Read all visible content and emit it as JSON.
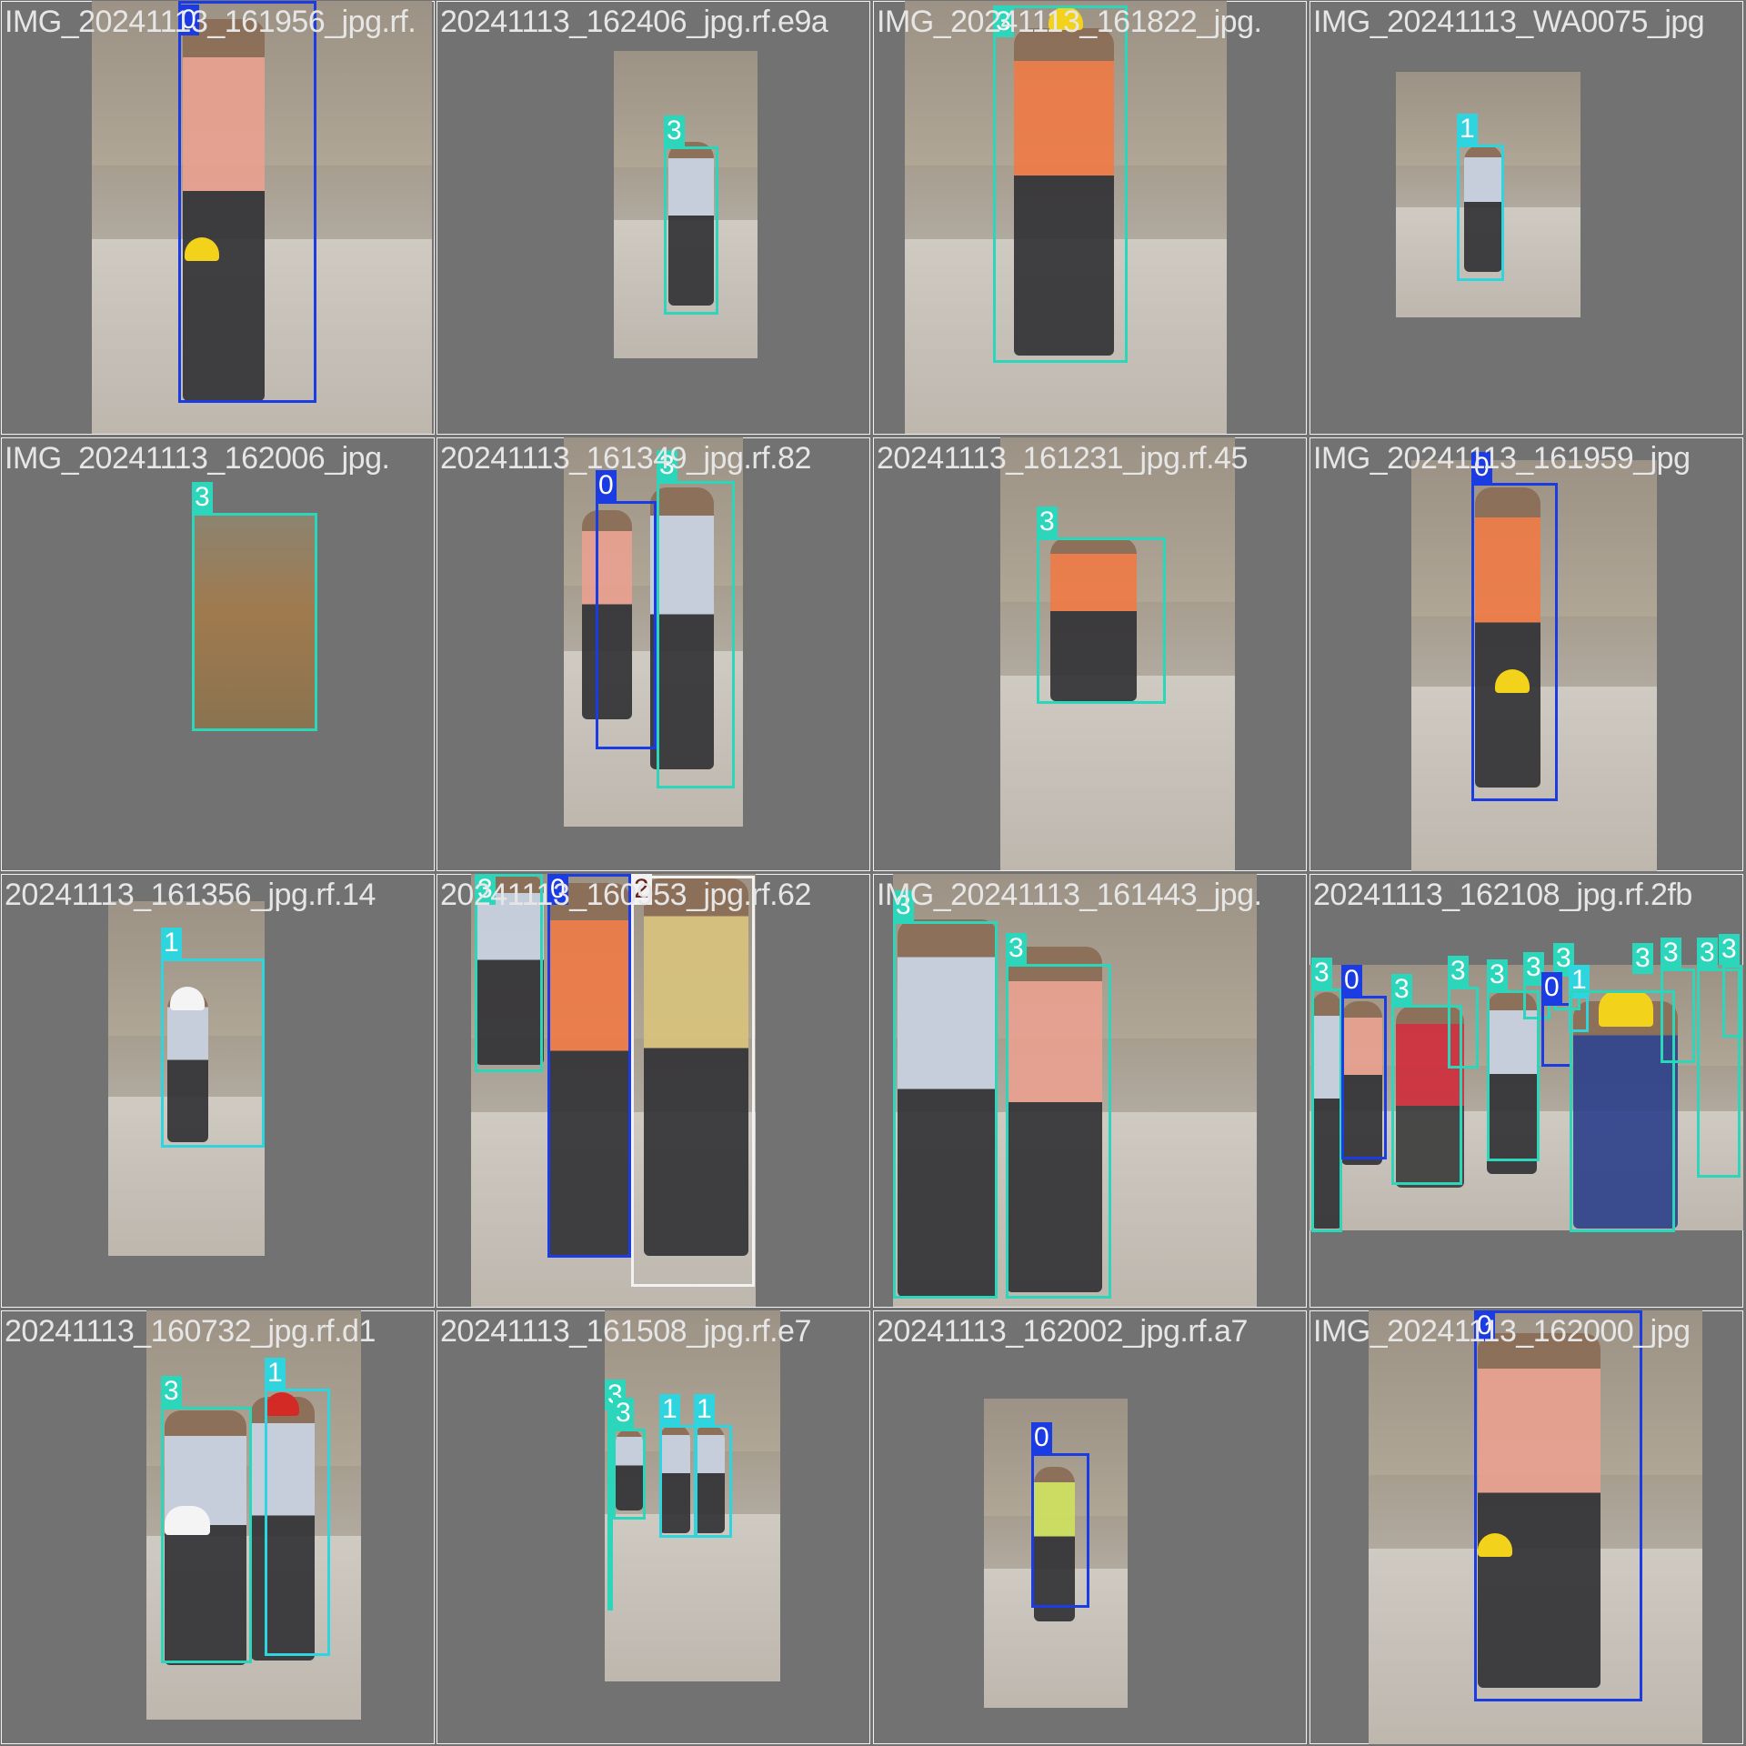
{
  "mosaic": {
    "tiles": [
      {
        "filename": "IMG_20241113_161956_jpg.rf.",
        "labels": [
          "0"
        ]
      },
      {
        "filename": "20241113_162406_jpg.rf.e9a",
        "labels": [
          "3"
        ]
      },
      {
        "filename": "IMG_20241113_161822_jpg.",
        "labels": [
          "3"
        ]
      },
      {
        "filename": "IMG_20241113_WA0075_jpg",
        "labels": [
          "1"
        ]
      },
      {
        "filename": "IMG_20241113_162006_jpg.",
        "labels": [
          "3"
        ]
      },
      {
        "filename": "20241113_161349_jpg.rf.82",
        "labels": [
          "0",
          "3"
        ]
      },
      {
        "filename": "20241113_161231_jpg.rf.45",
        "labels": [
          "3"
        ]
      },
      {
        "filename": "IMG_20241113_161959_jpg",
        "labels": [
          "0"
        ]
      },
      {
        "filename": "20241113_161356_jpg.rf.14",
        "labels": [
          "1"
        ]
      },
      {
        "filename": "20241113_160953_jpg.rf.62",
        "labels": [
          "3",
          "0",
          "2"
        ]
      },
      {
        "filename": "IMG_20241113_161443_jpg.",
        "labels": [
          "3",
          "3"
        ]
      },
      {
        "filename": "20241113_162108_jpg.rf.2fb",
        "labels": [
          "3",
          "0",
          "3",
          "3",
          "3",
          "3",
          "3",
          "0",
          "1",
          "3",
          "3",
          "3",
          "3"
        ]
      },
      {
        "filename": "20241113_160732_jpg.rf.d1",
        "labels": [
          "3",
          "1"
        ]
      },
      {
        "filename": "20241113_161508_jpg.rf.e7",
        "labels": [
          "3",
          "3",
          "1",
          "1"
        ]
      },
      {
        "filename": "20241113_162002_jpg.rf.a7",
        "labels": [
          "0"
        ]
      },
      {
        "filename": "IMG_20241113_162000_jpg",
        "labels": [
          "0"
        ]
      }
    ]
  },
  "class_colors": {
    "0": "#1b3ce2",
    "1": "#2ed4de",
    "2": "#f2f2f2",
    "3": "#2bd6bb"
  }
}
